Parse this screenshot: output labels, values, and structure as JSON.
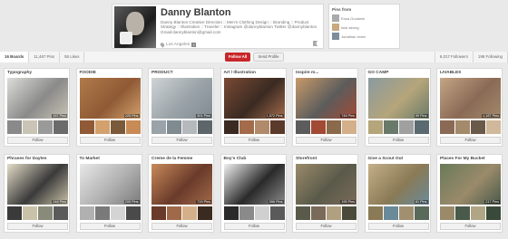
{
  "profile": {
    "name": "Danny Blanton",
    "bio": "Danny Blanton Creative Direction :: Men's Clothing Design :: Branding :: Product Strategy :: Illustration :: Traveler :: Instagram @dannyblanton Twitter @dannyblanton Gmail:dannyblanton@gmail.com",
    "location": "Los Angeles"
  },
  "pins_from": {
    "title": "Pins from",
    "items": [
      "Enza Goodwin",
      "look strong",
      "Jonathan Irvinn"
    ]
  },
  "stats": {
    "boards": "16 Boards",
    "pins": "11,467 Pins",
    "likes": "55 Likes",
    "followers": "8,017 Followers",
    "following": "198 Following"
  },
  "actions": {
    "follow_all": "Follow All",
    "send_profile": "Send Profile"
  },
  "boards": [
    {
      "title": "Typography",
      "pins": "157 Pins",
      "follow": "Follow"
    },
    {
      "title": "FOODIE",
      "pins": "225 Pins",
      "follow": "Follow"
    },
    {
      "title": "PRODUCT",
      "pins": "301 Pins",
      "follow": "Follow"
    },
    {
      "title": "Art / Illustration",
      "pins": "1,572 Pins",
      "follow": "Follow"
    },
    {
      "title": "Inspire m...",
      "pins": "748 Pins",
      "follow": "Follow"
    },
    {
      "title": "GO CAMP",
      "pins": "99 Pins",
      "follow": "Follow"
    },
    {
      "title": "LIVABLES",
      "pins": "1,187 Pins",
      "follow": "Follow"
    },
    {
      "title": "Phrases for Daytes",
      "pins": "248 Pins",
      "follow": "Follow"
    },
    {
      "title": "To Market",
      "pins": "205 Pins",
      "follow": "Follow"
    },
    {
      "title": "Creme de la Femme",
      "pins": "719 Pins",
      "follow": "Follow"
    },
    {
      "title": "Boy's Club",
      "pins": "556 Pins",
      "follow": "Follow"
    },
    {
      "title": "Storefront",
      "pins": "195 Pins",
      "follow": "Follow"
    },
    {
      "title": "Give a Scout Out",
      "pins": "81 Pins",
      "follow": "Follow"
    },
    {
      "title": "Places For My Bucket",
      "pins": "217 Pins",
      "follow": "Follow"
    }
  ],
  "board_colors": [
    [
      "#dcdcd8",
      "#8a8a8a",
      "#c9c4b5",
      "#9a9a9a",
      "#6b6b6b"
    ],
    [
      "#b07a4a",
      "#8f5a35",
      "#d2a16d",
      "#7a5a3a",
      "#c98b55"
    ],
    [
      "#cfd3d6",
      "#9aa3a8",
      "#7f8b91",
      "#b5b9bc",
      "#5c666b"
    ],
    [
      "#7a4a34",
      "#3a2a22",
      "#a36b4a",
      "#b08a6a",
      "#5a3a2a"
    ],
    [
      "#c89a6a",
      "#5c5c5c",
      "#a34a34",
      "#8a6a4a",
      "#d4b08a"
    ],
    [
      "#8a9aa0",
      "#b5a57a",
      "#6a7a6a",
      "#a0a0a0",
      "#5a6a70"
    ],
    [
      "#c4a585",
      "#8a6a55",
      "#a38a6a",
      "#6a5a4a",
      "#d0b89a"
    ],
    [
      "#e4ddc8",
      "#3a3a3a",
      "#c9c2a8",
      "#8a8a7a",
      "#5a5a5a"
    ],
    [
      "#e8e8e8",
      "#b0b0b0",
      "#7a7a7a",
      "#d4d4d4",
      "#4a4a4a"
    ],
    [
      "#c88a5a",
      "#6a3a2a",
      "#a06a4a",
      "#d4b08a",
      "#3a2a20"
    ],
    [
      "#f0f0f0",
      "#2a2a2a",
      "#8a8a8a",
      "#d0d0d0",
      "#5a5a5a"
    ],
    [
      "#9a8a6a",
      "#5a5a4a",
      "#7a6a5a",
      "#b0a080",
      "#4a4a3a"
    ],
    [
      "#c4b08a",
      "#8a7a55",
      "#6a8a9a",
      "#a09070",
      "#5a6a5a"
    ],
    [
      "#6a7a5a",
      "#9a8a6a",
      "#4a5a4a",
      "#b0a585",
      "#3a4a3a"
    ]
  ]
}
